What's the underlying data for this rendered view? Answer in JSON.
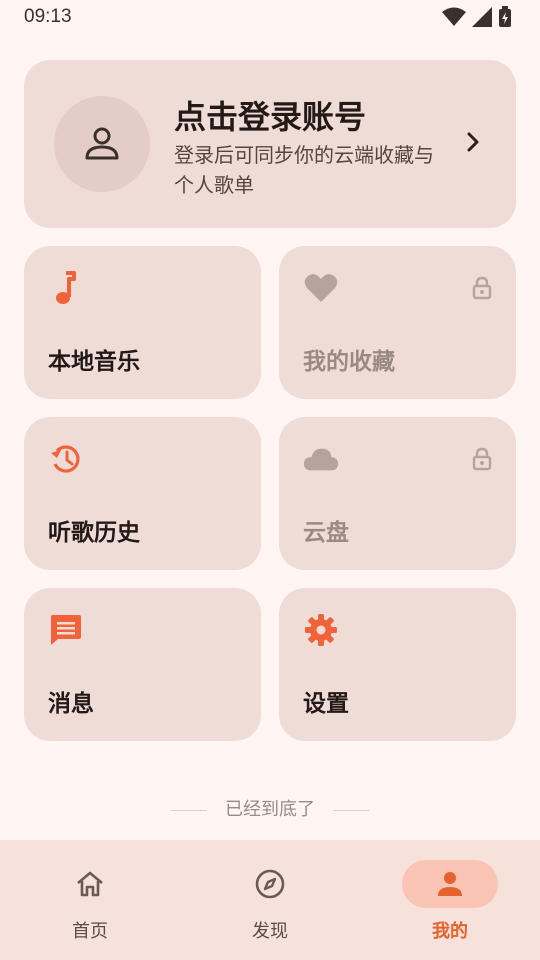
{
  "status_bar": {
    "time": "09:13",
    "icons": [
      "wifi-icon",
      "signal-icon",
      "battery-charging-icon"
    ]
  },
  "login_card": {
    "title": "点击登录账号",
    "subtitle": "登录后可同步你的云端收藏与个人歌单",
    "avatar_icon": "person-outline-icon",
    "arrow_icon": "chevron-right-icon"
  },
  "tiles": [
    {
      "label": "本地音乐",
      "icon": "music-note-icon",
      "locked": false
    },
    {
      "label": "我的收藏",
      "icon": "heart-icon",
      "locked": true
    },
    {
      "label": "听歌历史",
      "icon": "history-icon",
      "locked": false
    },
    {
      "label": "云盘",
      "icon": "cloud-icon",
      "locked": true
    },
    {
      "label": "消息",
      "icon": "message-icon",
      "locked": false
    },
    {
      "label": "设置",
      "icon": "gear-icon",
      "locked": false
    }
  ],
  "footer_note": "已经到底了",
  "bottom_nav": {
    "items": [
      {
        "label": "首页",
        "icon": "home-icon",
        "active": false
      },
      {
        "label": "发现",
        "icon": "compass-icon",
        "active": false
      },
      {
        "label": "我的",
        "icon": "person-icon",
        "active": true
      }
    ]
  },
  "colors": {
    "accent": "#f0623a",
    "card": "#f0dcd6",
    "background": "#fff6f3",
    "disabled": "#b5a39d"
  }
}
